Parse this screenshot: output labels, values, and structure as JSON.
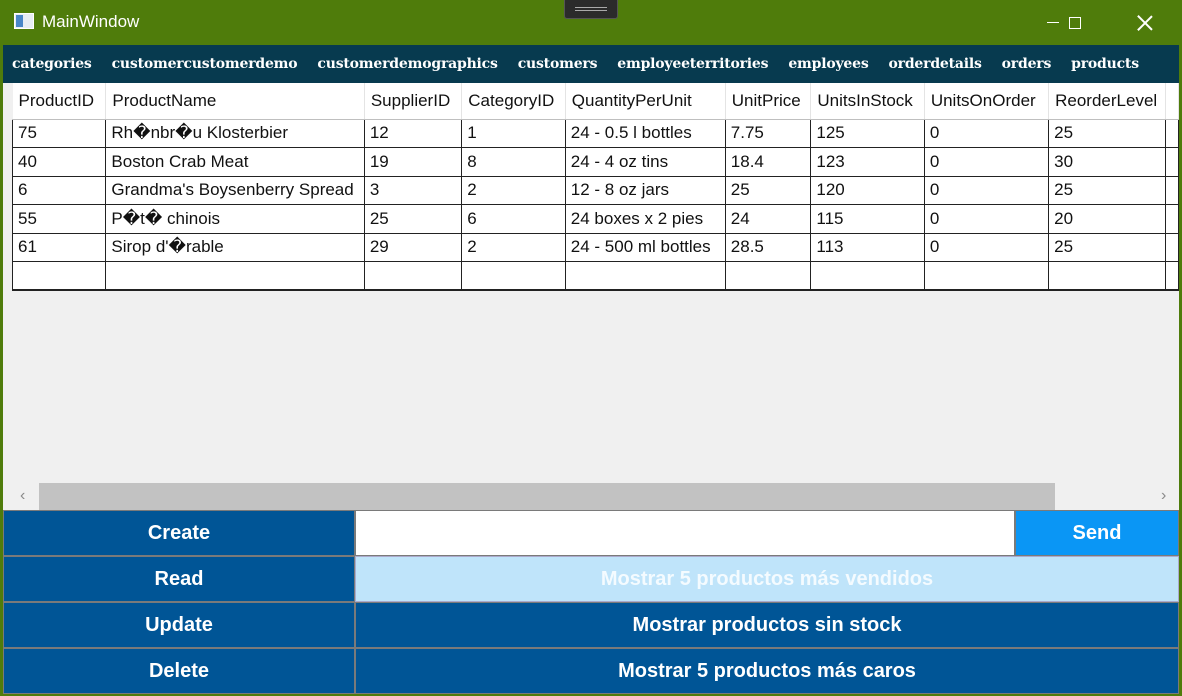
{
  "window": {
    "title": "MainWindow"
  },
  "menu": [
    "categories",
    "customercustomerdemo",
    "customerdemographics",
    "customers",
    "employeeterritories",
    "employees",
    "orderdetails",
    "orders",
    "products"
  ],
  "grid": {
    "columns": [
      "ProductID",
      "ProductName",
      "SupplierID",
      "CategoryID",
      "QuantityPerUnit",
      "UnitPrice",
      "UnitsInStock",
      "UnitsOnOrder",
      "ReorderLevel"
    ],
    "rows": [
      [
        "75",
        "Rh�nbr�u Klosterbier",
        "12",
        "1",
        "24 - 0.5 l bottles",
        "7.75",
        "125",
        "0",
        "25"
      ],
      [
        "40",
        "Boston Crab Meat",
        "19",
        "8",
        "24 - 4 oz tins",
        "18.4",
        "123",
        "0",
        "30"
      ],
      [
        "6",
        "Grandma's Boysenberry Spread",
        "3",
        "2",
        "12 - 8 oz jars",
        "25",
        "120",
        "0",
        "25"
      ],
      [
        "55",
        "P�t� chinois",
        "25",
        "6",
        "24 boxes x 2 pies",
        "24",
        "115",
        "0",
        "20"
      ],
      [
        "61",
        "Sirop d'�rable",
        "29",
        "2",
        "24 - 500 ml bottles",
        "28.5",
        "113",
        "0",
        "25"
      ],
      [
        "",
        "",
        "",
        "",
        "",
        "",
        "",
        "",
        ""
      ]
    ]
  },
  "buttons": {
    "create": "Create",
    "read": "Read",
    "update": "Update",
    "delete": "Delete",
    "send": "Send",
    "top_sold": "Mostrar 5 productos más vendidos",
    "no_stock": "Mostrar productos sin stock",
    "most_expensive": "Mostrar 5 productos más caros"
  },
  "input": {
    "value": ""
  },
  "colors": {
    "titlebar": "#4f7c0b",
    "menubar": "#073a4f",
    "button": "#005596",
    "send": "#0a96f5",
    "disabled": "#bfe4fa"
  }
}
